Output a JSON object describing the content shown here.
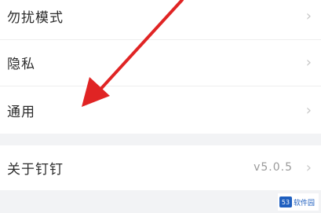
{
  "settings": {
    "items": [
      {
        "label": "勿扰模式",
        "chevron": "›"
      },
      {
        "label": "隐私",
        "chevron": "›"
      },
      {
        "label": "通用",
        "chevron": "›"
      }
    ],
    "about": {
      "label": "关于钉钉",
      "value": "v5.0.5",
      "chevron": "›"
    }
  },
  "annotation": {
    "arrow_color": "#e02424",
    "icon": "red-pointer-arrow"
  },
  "watermark": {
    "badge": "53",
    "text": "软件园"
  }
}
